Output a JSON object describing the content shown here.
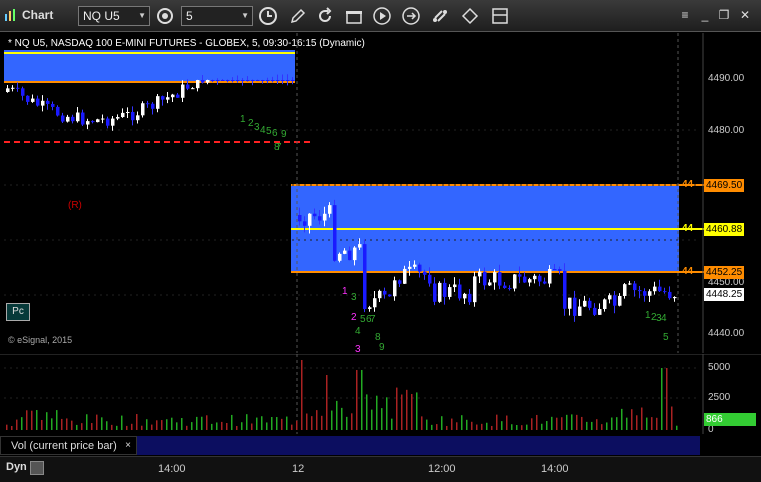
{
  "app": {
    "title": "Chart"
  },
  "toolbar": {
    "symbol": "NQ U5",
    "interval": "5",
    "icons": [
      "settings-icon",
      "clock-icon",
      "pencil-icon",
      "refresh-icon",
      "gift-icon",
      "play-icon",
      "swap-icon",
      "tag-icon",
      "layout-icon"
    ]
  },
  "chart": {
    "title": "* NQ U5, NASDAQ 100 E-MINI FUTURES - GLOBEX, 5, 09:30-16:15 (Dynamic)",
    "copyright": "© eSignal, 2015",
    "pc_button": "Pc",
    "r_label": "(R)",
    "y_ticks": [
      "4490.00",
      "4480.00",
      "4450.00",
      "4440.00"
    ],
    "markers": [
      {
        "label": "4469.50",
        "bg": "#ff8c00",
        "fg": "#000"
      },
      {
        "label": "4460.88",
        "bg": "#ffff00",
        "fg": "#000"
      },
      {
        "label": "4452.25",
        "bg": "#ff8c00",
        "fg": "#000"
      },
      {
        "label": "4448.25",
        "bg": "#ffffff",
        "fg": "#000"
      }
    ],
    "axis_left_labels": [
      "44",
      "44",
      "44"
    ],
    "seq_counts": {
      "a": [
        "1",
        "2",
        "3",
        "4",
        "5",
        "6",
        "7",
        "8",
        "9"
      ],
      "b": [
        "1",
        "2",
        "3"
      ],
      "c": [
        "3",
        "4",
        "5",
        "6",
        "7",
        "8",
        "9"
      ],
      "d": [
        "1",
        "2",
        "3",
        "4",
        "5"
      ]
    },
    "colors": {
      "zone": "#3366ff",
      "orange": "#ff8c00",
      "yellow": "#ffff00",
      "red_dash": "#ff2222",
      "up": "#ffffff",
      "down": "#1a1aff",
      "green_count": "#33aa33",
      "magenta": "#ff33ff"
    }
  },
  "volume": {
    "panel_label": "Vol (current price bar)",
    "close": "×",
    "y_ticks": [
      "5000",
      "2500",
      "0"
    ],
    "current": "866",
    "current_bg": "#33cc33"
  },
  "x_axis": {
    "dyn": "Dyn",
    "ticks": [
      "14:00",
      "12",
      "12:00",
      "14:00"
    ]
  }
}
